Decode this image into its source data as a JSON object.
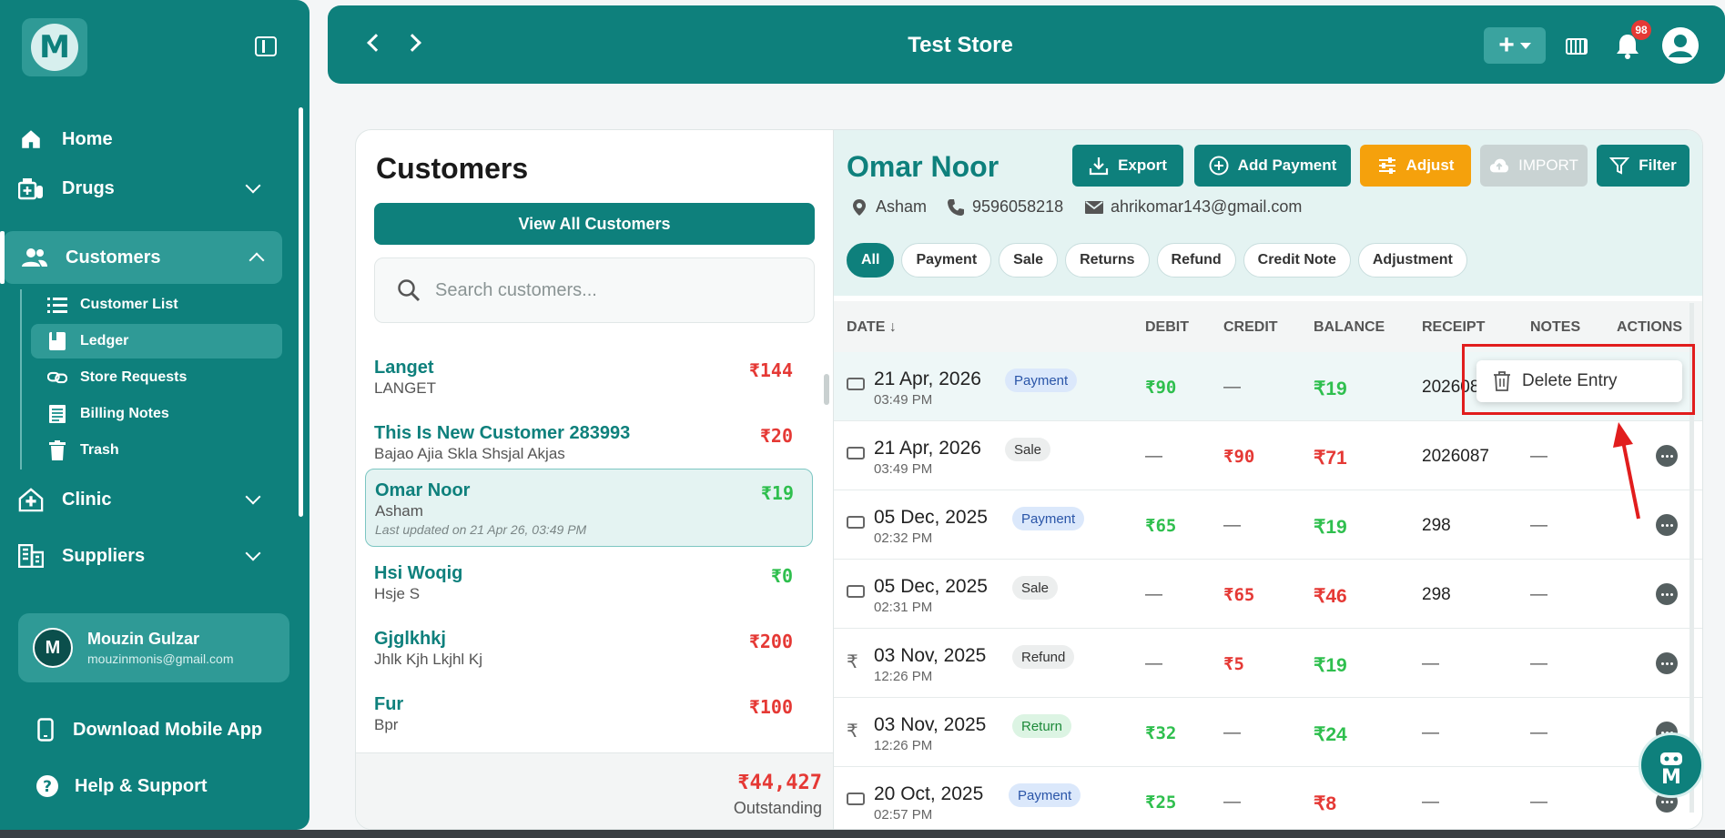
{
  "app": {
    "logo_letter": "M",
    "colors": {
      "primary": "#0e807c",
      "accent_orange": "#f5a10c",
      "negative": "#e53935",
      "positive": "#2fbf4e",
      "highlight_box": "#e11d1d"
    }
  },
  "sidebar": {
    "nav": [
      {
        "label": "Home",
        "icon": "home-icon"
      },
      {
        "label": "Drugs",
        "icon": "drugs-icon"
      },
      {
        "label": "Customers",
        "icon": "customers-icon"
      },
      {
        "label": "Clinic",
        "icon": "clinic-icon"
      },
      {
        "label": "Suppliers",
        "icon": "suppliers-icon"
      }
    ],
    "sub": [
      {
        "label": "Customer List",
        "icon": "list-icon"
      },
      {
        "label": "Ledger",
        "icon": "book-icon"
      },
      {
        "label": "Store Requests",
        "icon": "link-icon"
      },
      {
        "label": "Billing Notes",
        "icon": "notes-icon"
      },
      {
        "label": "Trash",
        "icon": "trash-icon"
      }
    ],
    "user": {
      "initial": "M",
      "name": "Mouzin Gulzar",
      "email": "mouzinmonis@gmail.com"
    },
    "download": "Download Mobile App",
    "help": "Help & Support"
  },
  "header": {
    "title": "Test Store",
    "notification_count": "98"
  },
  "customers": {
    "title": "Customers",
    "view_all": "View All Customers",
    "search_placeholder": "Search customers...",
    "list": [
      {
        "name": "Langet",
        "sub": "LANGET",
        "amount": "₹144",
        "status": "negative"
      },
      {
        "name": "This Is New Customer 283993",
        "sub": "Bajao Ajia Skla Shsjal Akjas",
        "amount": "₹20",
        "status": "negative"
      },
      {
        "name": "Omar Noor",
        "sub": "Asham",
        "amount": "₹19",
        "status": "positive",
        "updated": "Last updated on 21 Apr 26, 03:49 PM"
      },
      {
        "name": "Hsi Woqig",
        "sub": "Hsje S",
        "amount": "₹0",
        "status": "positive"
      },
      {
        "name": "Gjglkhkj",
        "sub": "Jhlk Kjh Lkjhl Kj",
        "amount": "₹200",
        "status": "negative"
      },
      {
        "name": "Fur",
        "sub": "Bpr",
        "amount": "₹100",
        "status": "negative"
      }
    ],
    "total": "₹44,427",
    "total_label": "Outstanding"
  },
  "ledger": {
    "name": "Omar Noor",
    "location": "Asham",
    "phone": "9596058218",
    "email": "ahrikomar143@gmail.com",
    "buttons": {
      "export": "Export",
      "add_payment": "Add Payment",
      "adjust": "Adjust",
      "import": "IMPORT",
      "filter": "Filter"
    },
    "filters": [
      "All",
      "Payment",
      "Sale",
      "Returns",
      "Refund",
      "Credit Note",
      "Adjustment"
    ],
    "columns": {
      "date": "DATE ↓",
      "debit": "DEBIT",
      "credit": "CREDIT",
      "balance": "BALANCE",
      "receipt": "RECEIPT",
      "notes": "NOTES",
      "actions": "ACTIONS"
    },
    "rows": [
      {
        "date": "21 Apr, 2026",
        "time": "03:49 PM",
        "type": "Payment",
        "debit": "₹90",
        "credit": "—",
        "balance": "₹19",
        "receipt": "2026087",
        "notes": "—"
      },
      {
        "date": "21 Apr, 2026",
        "time": "03:49 PM",
        "type": "Sale",
        "debit": "—",
        "credit": "₹90",
        "balance": "₹71",
        "receipt": "2026087",
        "notes": "—"
      },
      {
        "date": "05 Dec, 2025",
        "time": "02:32 PM",
        "type": "Payment",
        "debit": "₹65",
        "credit": "—",
        "balance": "₹19",
        "receipt": "298",
        "notes": "—"
      },
      {
        "date": "05 Dec, 2025",
        "time": "02:31 PM",
        "type": "Sale",
        "debit": "—",
        "credit": "₹65",
        "balance": "₹46",
        "receipt": "298",
        "notes": "—"
      },
      {
        "date": "03 Nov, 2025",
        "time": "12:26 PM",
        "type": "Refund",
        "debit": "—",
        "credit": "₹5",
        "balance": "₹19",
        "receipt": "—",
        "notes": "—"
      },
      {
        "date": "03 Nov, 2025",
        "time": "12:26 PM",
        "type": "Return",
        "debit": "₹32",
        "credit": "—",
        "balance": "₹24",
        "receipt": "—",
        "notes": "—"
      },
      {
        "date": "20 Oct, 2025",
        "time": "02:57 PM",
        "type": "Payment",
        "debit": "₹25",
        "credit": "—",
        "balance": "₹8",
        "receipt": "—",
        "notes": "—"
      }
    ],
    "row_menu": {
      "delete": "Delete Entry"
    }
  }
}
